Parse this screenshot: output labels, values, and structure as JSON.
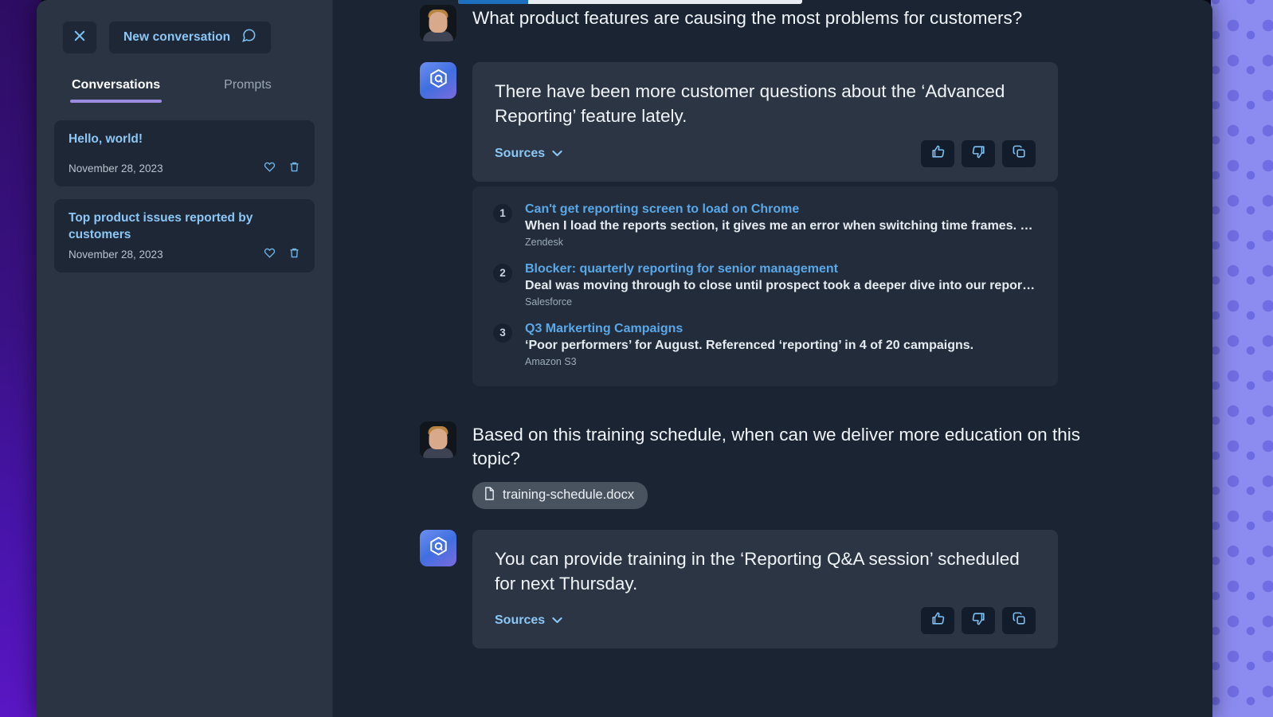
{
  "window": {
    "accent_purple": "#9b8ce0",
    "accent_blue": "#8cc7f5",
    "panel_bg": "#2b3442",
    "chat_bg": "#1b2433"
  },
  "sidebar": {
    "close_label": "close-icon",
    "new_conversation_label": "New conversation",
    "tabs": [
      {
        "label": "Conversations",
        "active": true
      },
      {
        "label": "Prompts",
        "active": false
      }
    ],
    "conversations": [
      {
        "title": "Hello, world!",
        "date": "November 28, 2023"
      },
      {
        "title": "Top product issues reported by customers",
        "date": "November 28, 2023"
      }
    ]
  },
  "chat": {
    "messages": [
      {
        "role": "user",
        "text": "What product features are causing the most problems for customers?"
      },
      {
        "role": "assistant",
        "text": "There have been more customer questions about the ‘Advanced Reporting’ feature lately.",
        "sources_label": "Sources",
        "sources": [
          {
            "num": "1",
            "title": "Can't get reporting screen to load on Chrome",
            "snippet": "When I load the reports section, it gives me an error when switching time frames. …",
            "origin": "Zendesk"
          },
          {
            "num": "2",
            "title": "Blocker: quarterly reporting for senior management",
            "snippet": "Deal was moving through to close until prospect took a deeper dive into our repor…",
            "origin": "Salesforce"
          },
          {
            "num": "3",
            "title": "Q3 Markerting Campaigns",
            "snippet": "‘Poor performers’ for August. Referenced ‘reporting’ in 4 of 20 campaigns.",
            "origin": "Amazon S3"
          }
        ]
      },
      {
        "role": "user",
        "text": "Based on this training schedule, when can we deliver more education on this topic?",
        "attachment": "training-schedule.docx"
      },
      {
        "role": "assistant",
        "text": "You can provide training in the ‘Reporting Q&A session’ scheduled for next Thursday.",
        "sources_label": "Sources"
      }
    ],
    "feedback": {
      "thumbs_up": "thumbs-up-icon",
      "thumbs_down": "thumbs-down-icon",
      "copy": "copy-icon"
    }
  }
}
